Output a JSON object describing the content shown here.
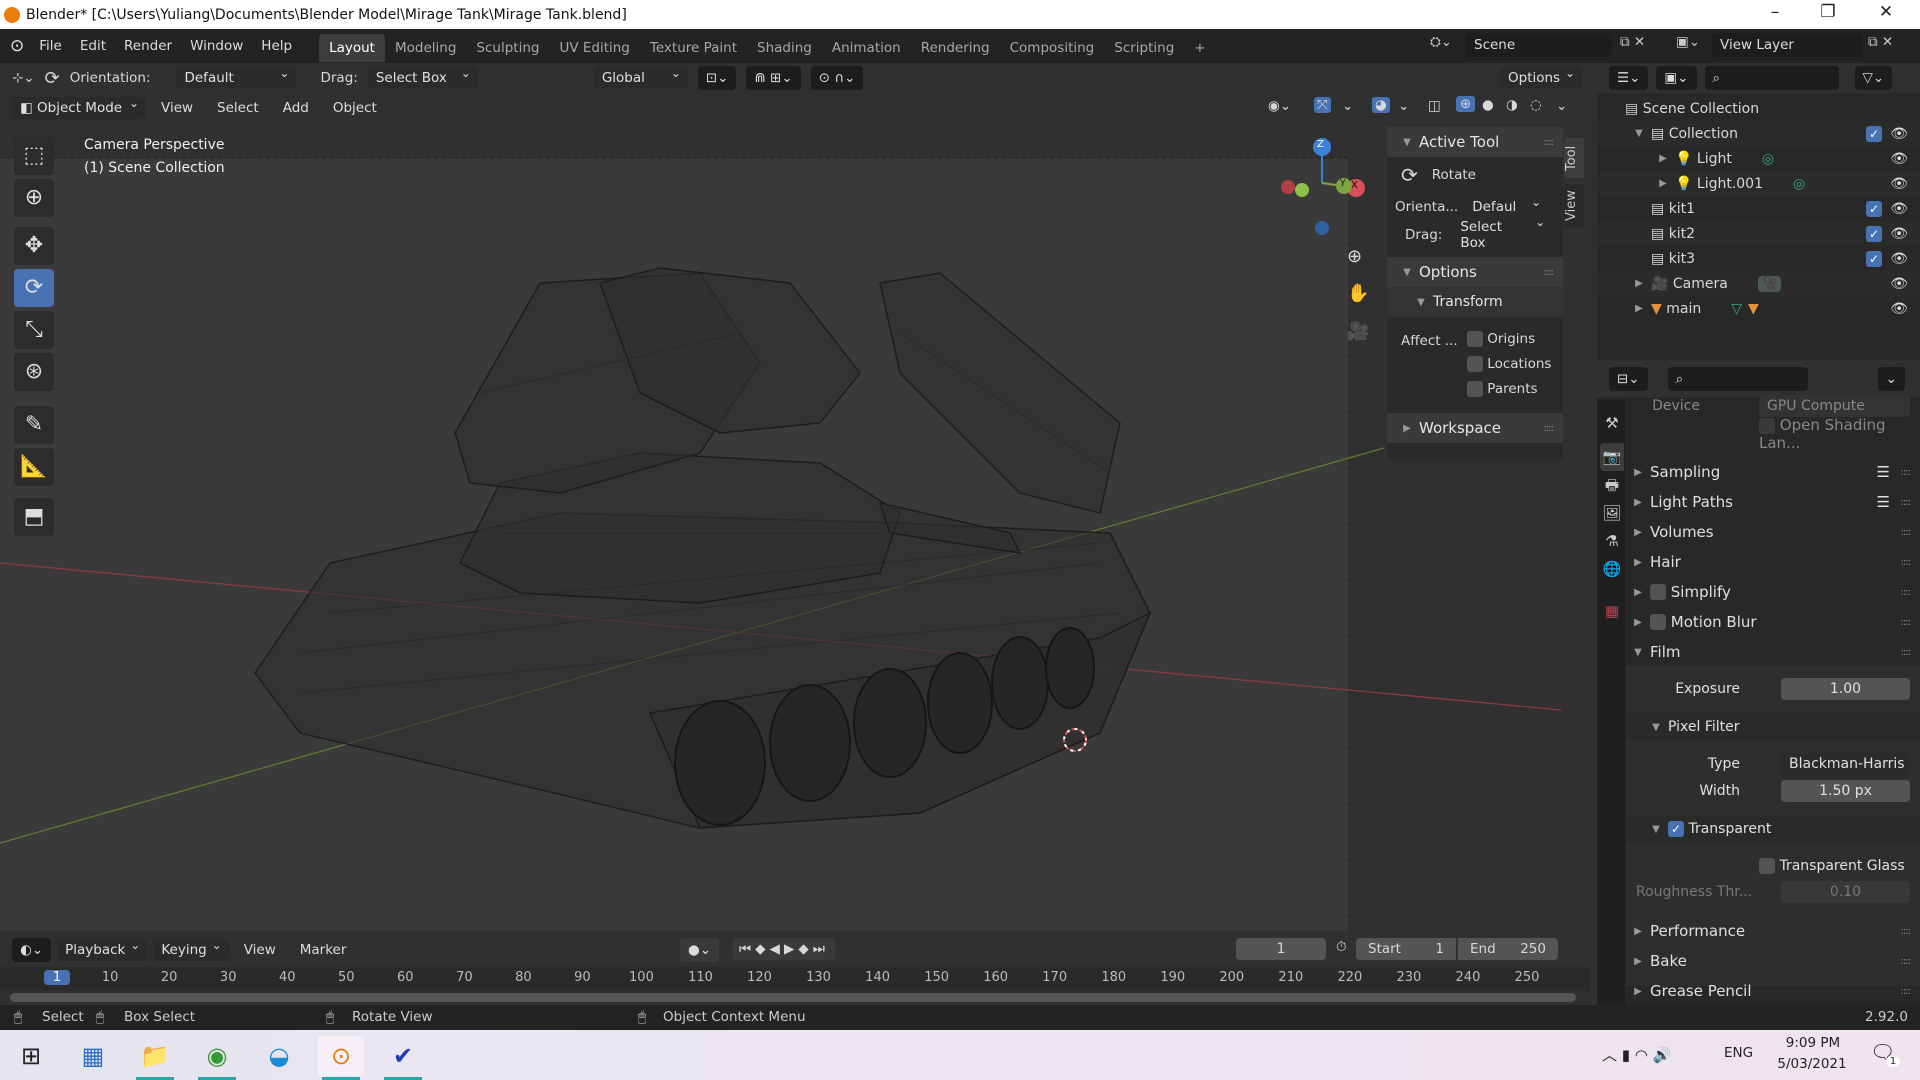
{
  "window": {
    "title": "Blender* [C:\\Users\\Yuliang\\Documents\\Blender Model\\Mirage Tank\\Mirage Tank.blend]",
    "minimize": "–",
    "maximize": "❐",
    "close": "✕"
  },
  "menu": [
    "File",
    "Edit",
    "Render",
    "Window",
    "Help"
  ],
  "workspaces": [
    "Layout",
    "Modeling",
    "Sculpting",
    "UV Editing",
    "Texture Paint",
    "Shading",
    "Animation",
    "Rendering",
    "Compositing",
    "Scripting",
    "+"
  ],
  "scene": {
    "name": "Scene",
    "view_layer": "View Layer"
  },
  "tool_header": {
    "orientation_label": "Orientation:",
    "orientation_value": "Default",
    "drag_label": "Drag:",
    "drag_value": "Select Box",
    "transform_orientation": "Global",
    "options": "Options"
  },
  "viewport_header": {
    "mode": "Object Mode",
    "menus": [
      "View",
      "Select",
      "Add",
      "Object"
    ]
  },
  "viewport": {
    "camera_label": "Camera Perspective",
    "collection_label": "(1) Scene Collection",
    "gizmo": {
      "z": "Z",
      "y": "Y",
      "x": "X"
    }
  },
  "npanel": {
    "tabs": [
      "Tool",
      "View"
    ],
    "active_tool_title": "Active Tool",
    "tool_name": "Rotate",
    "orientation_label": "Orienta...",
    "orientation_value": "Defaul",
    "drag_label": "Drag:",
    "drag_value": "Select Box",
    "options_title": "Options",
    "transform_title": "Transform",
    "affect_label": "Affect ...",
    "affect": [
      {
        "label": "Origins",
        "checked": false
      },
      {
        "label": "Locations",
        "checked": false
      },
      {
        "label": "Parents",
        "checked": false
      }
    ],
    "workspace_title": "Workspace"
  },
  "outliner": {
    "rows": [
      "Scene Collection",
      "Collection",
      "Light",
      "Light.001",
      "kit1",
      "kit2",
      "kit3",
      "Camera",
      "main"
    ]
  },
  "properties": {
    "device_label": "Device",
    "device_value": "GPU Compute",
    "osl": "Open Shading Lan...",
    "panels": [
      "Sampling",
      "Light Paths",
      "Volumes",
      "Hair",
      "Simplify",
      "Motion Blur",
      "Film"
    ],
    "exposure_label": "Exposure",
    "exposure": "1.00",
    "pixel_filter": "Pixel Filter",
    "type_label": "Type",
    "type_value": "Blackman-Harris",
    "width_label": "Width",
    "width_value": "1.50 px",
    "transparent": "Transparent",
    "transparent_glass": "Transparent Glass",
    "roughness_label": "Roughness Thr...",
    "roughness_value": "0.10",
    "bottom_panels": [
      "Performance",
      "Bake",
      "Grease Pencil"
    ]
  },
  "timeline": {
    "menus": [
      "Playback",
      "Keying",
      "View",
      "Marker"
    ],
    "current_frame": "1",
    "start_label": "Start",
    "start": "1",
    "end_label": "End",
    "end": "250",
    "ticks": [
      "1",
      "10",
      "20",
      "30",
      "40",
      "50",
      "60",
      "70",
      "80",
      "90",
      "100",
      "110",
      "120",
      "130",
      "140",
      "150",
      "160",
      "170",
      "180",
      "190",
      "200",
      "210",
      "220",
      "230",
      "240",
      "250"
    ]
  },
  "statusbar": {
    "select": "Select",
    "box_select": "Box Select",
    "rotate_view": "Rotate View",
    "context_menu": "Object Context Menu",
    "version": "2.92.0"
  },
  "taskbar": {
    "time": "9:09 PM",
    "date": "5/03/2021",
    "lang": "ENG",
    "notifications": "1"
  },
  "colors": {
    "accent": "#4772b3",
    "x_axis": "#d8505a",
    "y_axis": "#7aa540",
    "z_axis": "#3b82d8"
  }
}
